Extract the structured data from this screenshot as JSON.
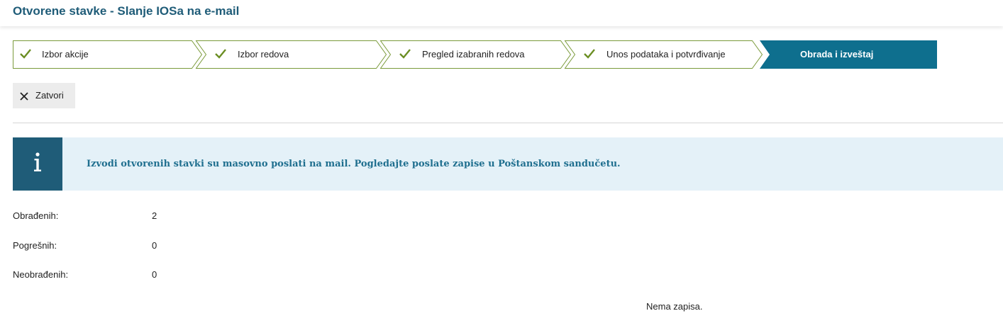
{
  "header": {
    "title": "Otvorene stavke - Slanje IOSa na e-mail"
  },
  "wizard": {
    "steps": [
      {
        "label": "Izbor akcije",
        "status": "done"
      },
      {
        "label": "Izbor redova",
        "status": "done"
      },
      {
        "label": "Pregled izabranih redova",
        "status": "done"
      },
      {
        "label": "Unos podataka i potvrđivanje",
        "status": "done"
      },
      {
        "label": "Obrada i izveštaj",
        "status": "active"
      }
    ],
    "colors": {
      "done_border": "#7a9a3a",
      "check": "#6b8e23",
      "active_fill": "#0e6f8e"
    }
  },
  "toolbar": {
    "close_label": "Zatvori",
    "close_icon": "close-icon"
  },
  "info": {
    "icon": "info-icon",
    "message": "Izvodi otvorenih stavki su masovno poslati na mail. Pogledajte poslate zapise u Poštanskom sandučetu."
  },
  "stats": [
    {
      "label": "Obrađenih:",
      "value": "2"
    },
    {
      "label": "Pogrešnih:",
      "value": "0"
    },
    {
      "label": "Neobrađenih:",
      "value": "0"
    }
  ],
  "table": {
    "empty_message": "Nema zapisa."
  }
}
